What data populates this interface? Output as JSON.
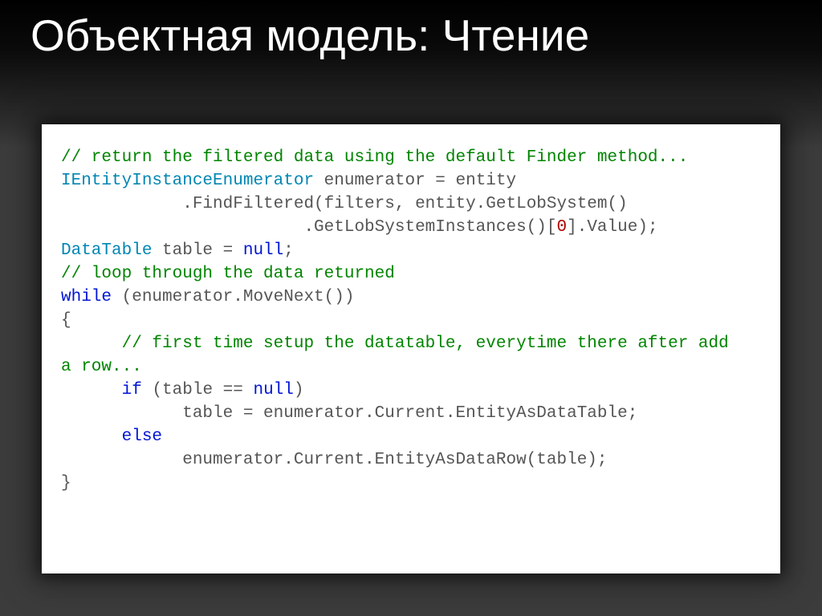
{
  "slide": {
    "title": "Объектная модель: Чтение"
  },
  "code": {
    "l1_comment": "// return the filtered data using the default Finder method...",
    "l2_type": "IEntityInstanceEnumerator",
    "l2_rest": " enumerator = entity",
    "l3": "            .FindFiltered(filters, entity.GetLobSystem()",
    "l4a": "                        .GetLobSystemInstances()[",
    "l4_num": "0",
    "l4b": "].Value);",
    "l5_type": "DataTable",
    "l5_mid": " table = ",
    "l5_null": "null",
    "l5_end": ";",
    "l6_comment": "// loop through the data returned",
    "l7_key": "while",
    "l7_rest": " (enumerator.MoveNext())",
    "l8": "{",
    "l9_comment": "      // first time setup the datatable, everytime there after add",
    "l9b_comment": "a row...",
    "l10_pre": "      ",
    "l10_if": "if",
    "l10_mid": " (table == ",
    "l10_null": "null",
    "l10_end": ")",
    "l11": "            table = enumerator.Current.EntityAsDataTable;",
    "l12_pre": "      ",
    "l12_else": "else",
    "l13": "            enumerator.Current.EntityAsDataRow(table);",
    "l14": "}"
  }
}
